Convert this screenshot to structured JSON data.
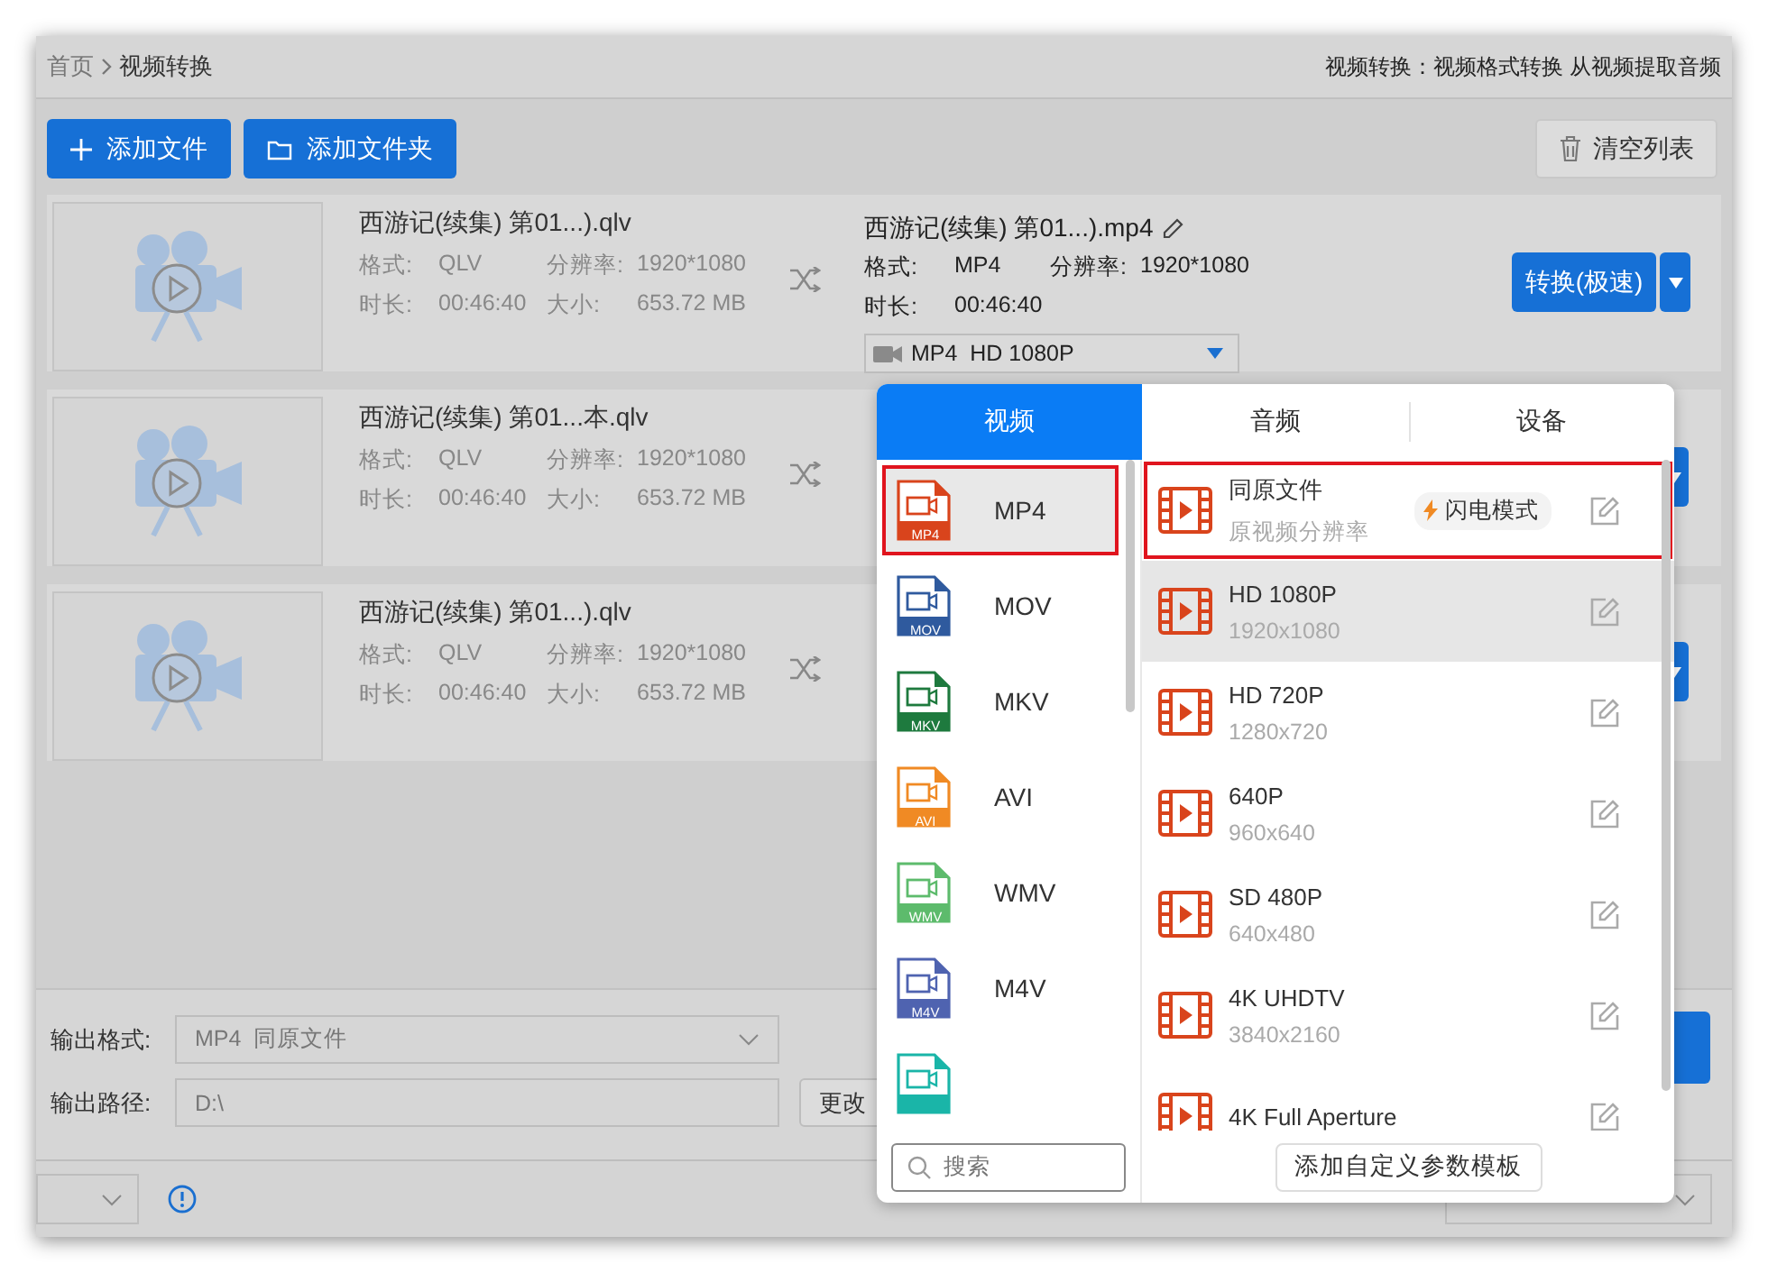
{
  "breadcrumb": [
    "首页",
    "视频转换"
  ],
  "header_hint": "视频转换：视频格式转换 从视频提取音频",
  "toolbar": {
    "add_file": "添加文件",
    "add_folder": "添加文件夹",
    "clear": "清空列表"
  },
  "files": [
    {
      "name": "西游记(续集) 第01...).qlv",
      "format_label": "格式:",
      "format": "QLV",
      "resolution_label": "分辨率:",
      "resolution": "1920*1080",
      "duration_label": "时长:",
      "duration": "00:46:40",
      "size_label": "大小:",
      "size": "653.72 MB",
      "output": {
        "name": "西游记(续集) 第01...).mp4",
        "format_label": "格式:",
        "format": "MP4",
        "resolution_label": "分辨率:",
        "resolution": "1920*1080",
        "duration_label": "时长:",
        "duration": "00:46:40",
        "preset": "MP4  HD 1080P",
        "convert": "转换(极速)"
      }
    },
    {
      "name": "西游记(续集) 第01...本.qlv",
      "format_label": "格式:",
      "format": "QLV",
      "resolution_label": "分辨率:",
      "resolution": "1920*1080",
      "duration_label": "时长:",
      "duration": "00:46:40",
      "size_label": "大小:",
      "size": "653.72 MB"
    },
    {
      "name": "西游记(续集) 第01...).qlv",
      "format_label": "格式:",
      "format": "QLV",
      "resolution_label": "分辨率:",
      "resolution": "1920*1080",
      "duration_label": "时长:",
      "duration": "00:46:40",
      "size_label": "大小:",
      "size": "653.72 MB"
    }
  ],
  "output": {
    "format_label": "输出格式:",
    "format_value": "MP4  同原文件",
    "path_label": "输出路径:",
    "path_value": "D:\\",
    "change_button": "更改"
  },
  "format_popup": {
    "tabs": [
      {
        "label": "视频",
        "selected": true
      },
      {
        "label": "音频",
        "selected": false
      },
      {
        "label": "设备",
        "selected": false
      }
    ],
    "formats": [
      {
        "label": "MP4",
        "badge": "MP4",
        "color": "#d9441c",
        "selected": true
      },
      {
        "label": "MOV",
        "badge": "MOV",
        "color": "#2f5a9e",
        "selected": false
      },
      {
        "label": "MKV",
        "badge": "MKV",
        "color": "#1e7a3e",
        "selected": false
      },
      {
        "label": "AVI",
        "badge": "AVI",
        "color": "#f08a24",
        "selected": false
      },
      {
        "label": "WMV",
        "badge": "WMV",
        "color": "#5dbb6c",
        "selected": false
      },
      {
        "label": "M4V",
        "badge": "M4V",
        "color": "#4f63b0",
        "selected": false
      },
      {
        "color": "#1ab5a8",
        "selected": false
      }
    ],
    "presets": [
      {
        "name": "同原文件",
        "detail": "原视频分辨率",
        "badge": "闪电模式",
        "selected": true,
        "highlighted": false
      },
      {
        "name": "HD 1080P",
        "detail": "1920x1080",
        "selected": false,
        "highlighted": true
      },
      {
        "name": "HD 720P",
        "detail": "1280x720",
        "selected": false,
        "highlighted": false
      },
      {
        "name": "640P",
        "detail": "960x640",
        "selected": false,
        "highlighted": false
      },
      {
        "name": "SD 480P",
        "detail": "640x480",
        "selected": false,
        "highlighted": false
      },
      {
        "name": "4K UHDTV",
        "detail": "3840x2160",
        "selected": false,
        "highlighted": false
      },
      {
        "name": "4K Full Aperture",
        "selected": false,
        "highlighted": false
      }
    ],
    "search_placeholder": "搜索",
    "add_template": "添加自定义参数模板"
  }
}
